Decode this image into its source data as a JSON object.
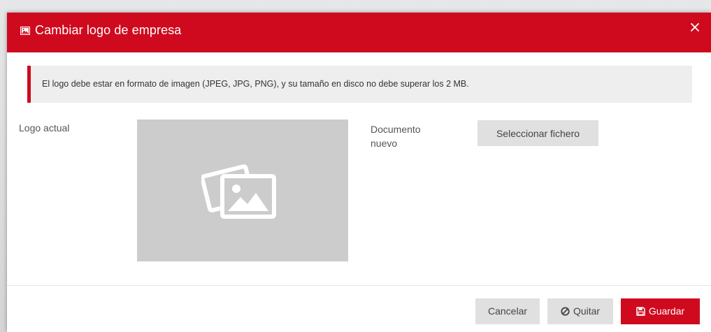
{
  "modal": {
    "title": "Cambiar logo de empresa",
    "title_icon": "image-icon",
    "close_icon": "close-icon"
  },
  "alert": {
    "text": "El logo debe estar en formato de imagen (JPEG, JPG, PNG), y su tamaño en disco no debe superar los 2 MB."
  },
  "form": {
    "current_logo_label": "Logo actual",
    "current_logo_placeholder_icon": "images-icon",
    "new_document_label": "Documento nuevo",
    "select_file_label": "Seleccionar fichero"
  },
  "footer": {
    "cancel_label": "Cancelar",
    "remove_label": "Quitar",
    "remove_icon": "ban-icon",
    "save_label": "Guardar",
    "save_icon": "floppy-disk-icon"
  },
  "colors": {
    "accent": "#cf0a1e",
    "placeholder_bg": "#cccccc",
    "button_bg": "#e0e0e0",
    "alert_bg": "#eeeeee"
  }
}
